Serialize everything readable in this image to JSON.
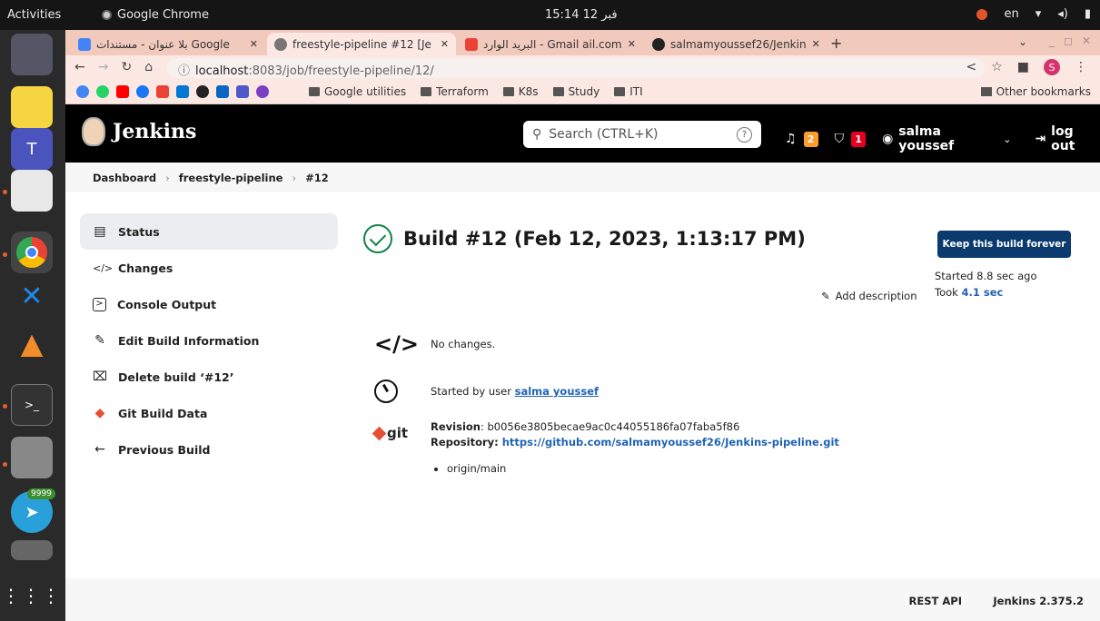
{
  "topbar": {
    "activities": "Activities",
    "app_name": "Google Chrome",
    "clock": "15:14 12 فبر",
    "lang": "en"
  },
  "tabs": [
    {
      "label": "بلا عنوان - مستندات Google",
      "color": "#4285f4"
    },
    {
      "label": "freestyle-pipeline #12 [Je",
      "color": "#555555"
    },
    {
      "label": "البريد الوارد - Gmail ail.com",
      "color": "#ea4335"
    },
    {
      "label": "salmamyoussef26/Jenkin",
      "color": "#222222"
    }
  ],
  "address": {
    "host": "localhost",
    "path": ":8083/job/freestyle-pipeline/12/"
  },
  "bookmarks": {
    "folders": [
      "Google utilities",
      "Terraform",
      "K8s",
      "Study",
      "ITI"
    ],
    "other": "Other bookmarks"
  },
  "jenkins": {
    "name": "Jenkins",
    "search_placeholder": "Search (CTRL+K)",
    "notifications_count": "2",
    "security_count": "1",
    "user": "salma youssef",
    "logout": "log out"
  },
  "breadcrumb": [
    "Dashboard",
    "freestyle-pipeline",
    "#12"
  ],
  "sidepanel": [
    {
      "label": "Status",
      "icon": "document-icon",
      "glyph": "▤"
    },
    {
      "label": "Changes",
      "icon": "code-icon",
      "glyph": "</>"
    },
    {
      "label": "Console Output",
      "icon": "terminal-icon",
      "glyph": "⌨"
    },
    {
      "label": "Edit Build Information",
      "icon": "edit-icon",
      "glyph": "✎"
    },
    {
      "label": "Delete build ‘#12’",
      "icon": "trash-icon",
      "glyph": "🗑"
    },
    {
      "label": "Git Build Data",
      "icon": "git-icon",
      "glyph": "◆"
    },
    {
      "label": "Previous Build",
      "icon": "arrow-left-icon",
      "glyph": "←"
    }
  ],
  "build": {
    "title": "Build #12 (Feb 12, 2023, 1:13:17 PM)",
    "keep_button": "Keep this build forever",
    "started": "Started 8.8 sec ago",
    "took_prefix": "Took ",
    "took_value": "4.1 sec",
    "add_description": "Add description",
    "changes_text": "No changes.",
    "started_by_prefix": "Started by user ",
    "started_by_user": "salma youssef",
    "revision_label": "Revision",
    "revision_value": ": b0056e3805becae9ac0c44055186fa07faba5f86",
    "repository_label": "Repository",
    "repository_value": "https://github.com/salmamyoussef26/Jenkins-pipeline.git",
    "branch": "origin/main",
    "git_word": "git"
  },
  "footer": {
    "rest_api": "REST API",
    "version": "Jenkins 2.375.2"
  },
  "dock_badge": "9999"
}
